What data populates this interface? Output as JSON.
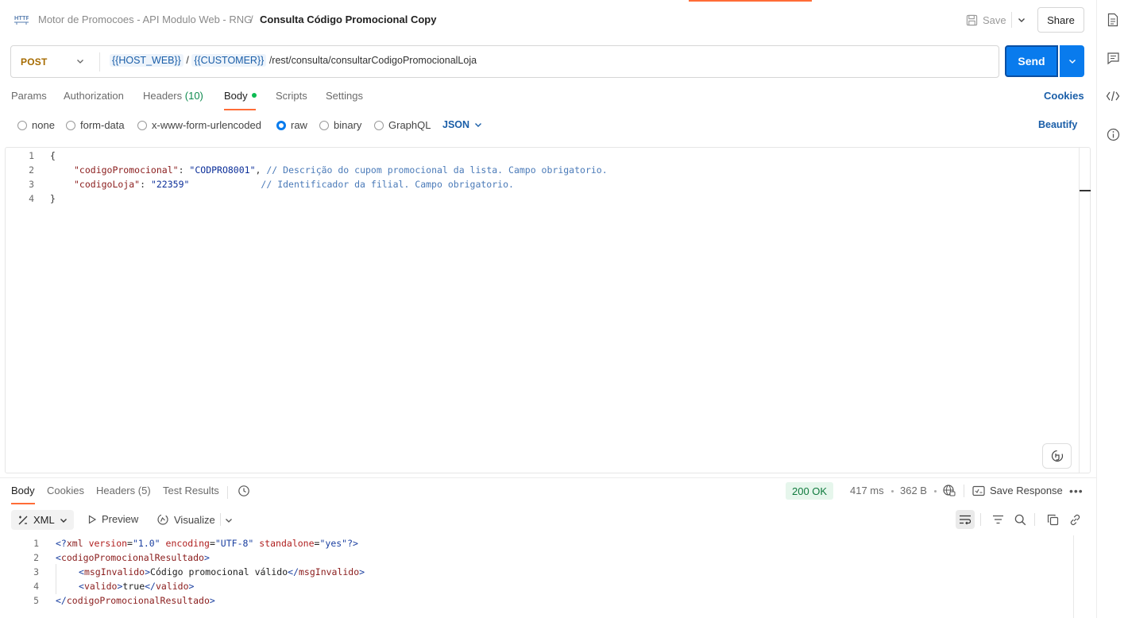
{
  "header": {
    "breadcrumb_parent": "Motor de Promocoes - API Modulo Web - RNG",
    "breadcrumb_separator": "/",
    "breadcrumb_current": "Consulta Código Promocional Copy",
    "save_label": "Save",
    "share_label": "Share",
    "accent_color": "#ff6c37"
  },
  "request": {
    "method": "POST",
    "method_color": "#a66b00",
    "url_var_host": "{{HOST_WEB}}",
    "url_slash": "/",
    "url_var_customer": "{{CUSTOMER}}",
    "url_path": "/rest/consulta/consultarCodigoPromocionalLoja",
    "send_label": "Send",
    "send_color": "#097bed"
  },
  "request_tabs": {
    "params": "Params",
    "authorization": "Authorization",
    "headers": "Headers",
    "headers_count": "(10)",
    "body": "Body",
    "scripts": "Scripts",
    "settings": "Settings",
    "active": "Body",
    "cookies": "Cookies"
  },
  "body_types": {
    "none": "none",
    "form_data": "form-data",
    "urlencoded": "x-www-form-urlencoded",
    "raw": "raw",
    "binary": "binary",
    "graphql": "GraphQL",
    "selected": "raw",
    "language": "JSON",
    "beautify": "Beautify"
  },
  "request_body": {
    "line_numbers": [
      "1",
      "2",
      "3",
      "4"
    ],
    "open_brace": "{",
    "key1": "\"codigoPromocional\"",
    "colon": ": ",
    "val1": "\"CODPRO8001\"",
    "comma": ",",
    "comment1": " // Descrição do cupom promocional da lista. Campo obrigatorio.",
    "key2": "\"codigoLoja\"",
    "val2": "\"22359\"",
    "comment2": "             // Identificador da filial. Campo obrigatorio.",
    "close_brace": "}"
  },
  "response_tabs": {
    "body": "Body",
    "cookies": "Cookies",
    "headers": "Headers",
    "headers_count": "(5)",
    "test_results": "Test Results",
    "active": "Body"
  },
  "response_meta": {
    "status": "200 OK",
    "status_color": "#0f7a3d",
    "time": "417 ms",
    "size": "362 B",
    "save_response": "Save Response"
  },
  "response_toolbar": {
    "format": "XML",
    "preview": "Preview",
    "visualize": "Visualize"
  },
  "response_body": {
    "line_numbers": [
      "1",
      "2",
      "3",
      "4",
      "5"
    ],
    "l1_open": "<?",
    "l1_tag": "xml",
    "l1_attr1": "version",
    "l1_val1": "\"1.0\"",
    "l1_attr2": "encoding",
    "l1_val2": "\"UTF-8\"",
    "l1_attr3": "standalone",
    "l1_val3": "\"yes\"",
    "l1_close": "?>",
    "root_tag": "codigoPromocionalResultado",
    "msg_tag": "msgInvalido",
    "msg_text": "Código promocional válido",
    "valido_tag": "valido",
    "valido_text": "true"
  },
  "icons": {
    "http": "http-icon",
    "save": "save-icon",
    "chevron": "chevron-down-icon",
    "docs": "document-icon",
    "comments": "comment-icon",
    "code": "code-icon",
    "info": "info-icon",
    "history": "history-icon",
    "globe": "globe-icon",
    "save_response": "save-response-icon",
    "more": "more-icon",
    "wrap": "wrap-icon",
    "filter": "filter-icon",
    "search": "search-icon",
    "copy": "copy-icon",
    "link": "link-icon",
    "preview": "play-icon",
    "visualize": "visualize-icon",
    "format": "format-icon",
    "cursor_hint": "hand-icon"
  }
}
